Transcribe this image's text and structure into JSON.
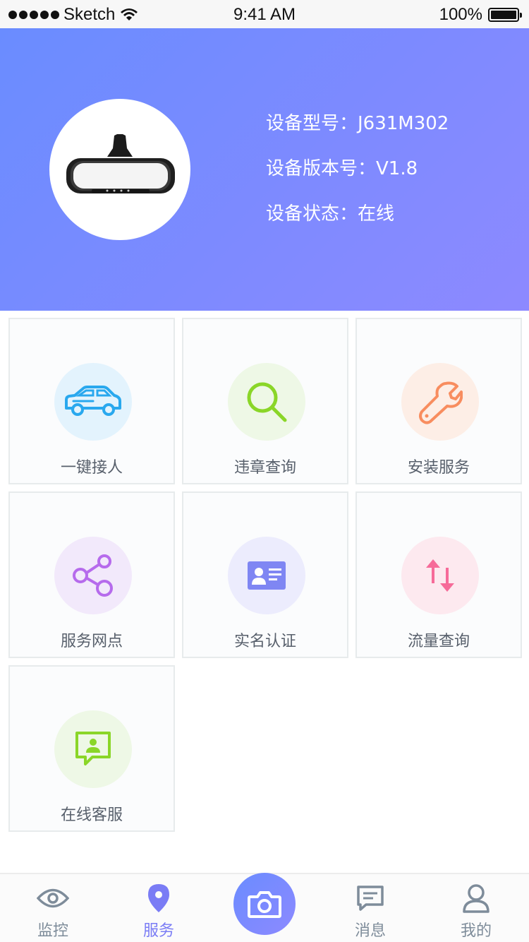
{
  "status_bar": {
    "carrier": "Sketch",
    "time": "9:41 AM",
    "battery": "100%"
  },
  "device": {
    "model_line": "设备型号：J631M302",
    "version_line": "设备版本号：V1.8",
    "status_line": "设备状态：在线",
    "image": "rearview-mirror-device"
  },
  "services": [
    {
      "label": "一键接人",
      "icon": "car-icon",
      "color": "#29a8ee",
      "bg": "#e3f3fd"
    },
    {
      "label": "违章查询",
      "icon": "search-icon",
      "color": "#8ad628",
      "bg": "#eef8e6"
    },
    {
      "label": "安装服务",
      "icon": "wrench-icon",
      "color": "#f88d5f",
      "bg": "#fdeee6"
    },
    {
      "label": "服务网点",
      "icon": "share-icon",
      "color": "#b66bec",
      "bg": "#f2e9fb"
    },
    {
      "label": "实名认证",
      "icon": "id-card-icon",
      "color": "#7f86f3",
      "bg": "#ececfd"
    },
    {
      "label": "流量查询",
      "icon": "transfer-icon",
      "color": "#f66b99",
      "bg": "#fde9ef"
    },
    {
      "label": "在线客服",
      "icon": "chat-user-icon",
      "color": "#8ad628",
      "bg": "#eef8e6"
    }
  ],
  "tabs": [
    {
      "label": "监控",
      "icon": "eye-icon"
    },
    {
      "label": "服务",
      "icon": "location-pin-icon"
    },
    {
      "label": "",
      "icon": "camera-icon"
    },
    {
      "label": "消息",
      "icon": "message-icon"
    },
    {
      "label": "我的",
      "icon": "user-icon"
    }
  ],
  "colors": {
    "accent": "#7a7cf5",
    "header_gradient_start": "#6a8cff",
    "header_gradient_end": "#8d89ff",
    "tab_inactive": "#7e8c9a"
  }
}
